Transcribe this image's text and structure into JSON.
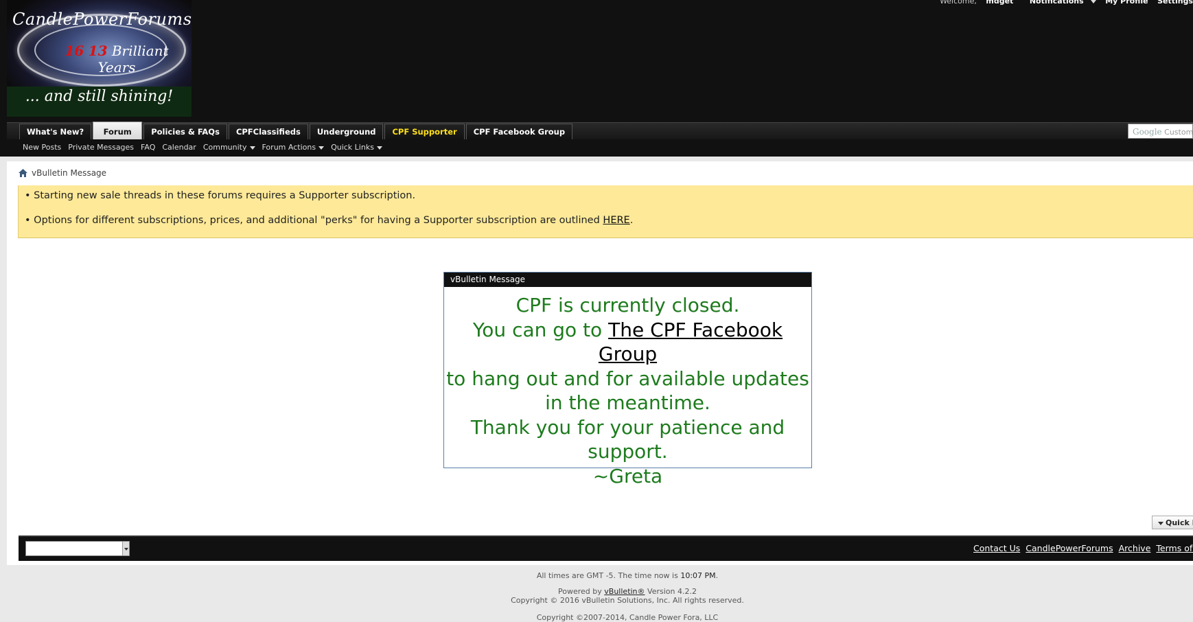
{
  "header": {
    "logo": {
      "title": "CandlePowerForums",
      "years_num_old": "16",
      "years_num_new": "13",
      "years_text": "Brilliant Years",
      "tagline": "... and still shining!"
    },
    "toplinks": {
      "welcome": "Welcome,",
      "username": "mdget",
      "notifications": "Notifications",
      "my_profile": "My Profile",
      "settings": "Settings"
    }
  },
  "nav": {
    "tabs": [
      {
        "label": "What's New?"
      },
      {
        "label": "Forum"
      },
      {
        "label": "Policies & FAQs"
      },
      {
        "label": "CPFClassifieds"
      },
      {
        "label": "Underground"
      },
      {
        "label": "CPF Supporter"
      },
      {
        "label": "CPF Facebook Group"
      }
    ],
    "search_brand": "Google",
    "search_text": "Custom Search",
    "subnav": [
      {
        "label": "New Posts"
      },
      {
        "label": "Private Messages"
      },
      {
        "label": "FAQ"
      },
      {
        "label": "Calendar"
      },
      {
        "label": "Community"
      },
      {
        "label": "Forum Actions"
      },
      {
        "label": "Quick Links"
      }
    ]
  },
  "breadcrumb": {
    "current": "vBulletin Message"
  },
  "notice": {
    "line1": "• Starting new sale threads in these forums requires a Supporter subscription.",
    "line2_prefix": "• Options for different subscriptions, prices, and additional \"perks\" for having a Supporter subscription are outlined ",
    "line2_link": "HERE",
    "line2_suffix": "."
  },
  "message": {
    "title": "vBulletin Message",
    "line1": "CPF is currently closed.",
    "line2_prefix": "You can go to ",
    "line2_link": "The CPF Facebook Group",
    "line3": "to hang out and for available updates",
    "line4": "in the meantime.",
    "line5": "Thank you for your patience and",
    "line6": "support.",
    "line7": "~Greta"
  },
  "quick_nav": {
    "label": "Quick Navigation"
  },
  "footer": {
    "links": [
      {
        "label": "Contact Us"
      },
      {
        "label": "CandlePowerForums"
      },
      {
        "label": "Archive"
      },
      {
        "label": "Terms of Service"
      }
    ]
  },
  "bottom": {
    "time_prefix": "All times are GMT -5. The time now is ",
    "time_value": "10:07 PM",
    "time_suffix": ".",
    "powered_prefix": "Powered by ",
    "powered_link": "vBulletin®",
    "powered_suffix": " Version 4.2.2",
    "copyright1": "Copyright © 2016 vBulletin Solutions, Inc. All rights reserved.",
    "copyright2": "Copyright ©2007-2014, Candle Power Fora, LLC"
  }
}
